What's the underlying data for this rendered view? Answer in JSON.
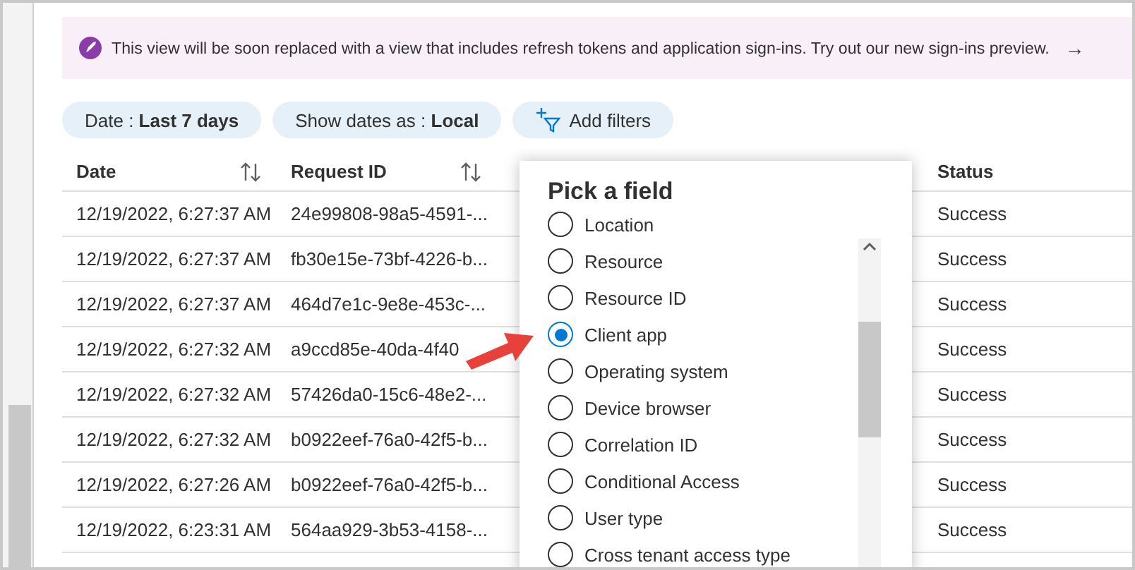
{
  "banner": {
    "text": "This view will be soon replaced with a view that includes refresh tokens and application sign-ins. Try out our new sign-ins preview.",
    "arrow": "→"
  },
  "filters": [
    {
      "label": "Date : ",
      "value": "Last 7 days"
    },
    {
      "label": "Show dates as : ",
      "value": "Local"
    }
  ],
  "add_filters": "Add filters",
  "table": {
    "columns": [
      {
        "label": "Date",
        "sortable": true
      },
      {
        "label": "Request ID",
        "sortable": true
      },
      {
        "label": "Status",
        "sortable": false
      }
    ],
    "rows": [
      {
        "date": "12/19/2022, 6:27:37 AM",
        "request_id": "24e99808-98a5-4591-...",
        "status": "Success"
      },
      {
        "date": "12/19/2022, 6:27:37 AM",
        "request_id": "fb30e15e-73bf-4226-b...",
        "status": "Success"
      },
      {
        "date": "12/19/2022, 6:27:37 AM",
        "request_id": "464d7e1c-9e8e-453c-...",
        "status": "Success"
      },
      {
        "date": "12/19/2022, 6:27:32 AM",
        "request_id": "a9ccd85e-40da-4f40",
        "status": "Success"
      },
      {
        "date": "12/19/2022, 6:27:32 AM",
        "request_id": "57426da0-15c6-48e2-...",
        "status": "Success"
      },
      {
        "date": "12/19/2022, 6:27:32 AM",
        "request_id": "b0922eef-76a0-42f5-b...",
        "status": "Success"
      },
      {
        "date": "12/19/2022, 6:27:26 AM",
        "request_id": "b0922eef-76a0-42f5-b...",
        "status": "Success"
      },
      {
        "date": "12/19/2022, 6:23:31 AM",
        "request_id": "564aa929-3b53-4158-...",
        "status": "Success"
      }
    ]
  },
  "popup": {
    "title": "Pick a field",
    "options": [
      {
        "label": "Location",
        "selected": false
      },
      {
        "label": "Resource",
        "selected": false
      },
      {
        "label": "Resource ID",
        "selected": false
      },
      {
        "label": "Client app",
        "selected": true
      },
      {
        "label": "Operating system",
        "selected": false
      },
      {
        "label": "Device browser",
        "selected": false
      },
      {
        "label": "Correlation ID",
        "selected": false
      },
      {
        "label": "Conditional Access",
        "selected": false
      },
      {
        "label": "User type",
        "selected": false
      },
      {
        "label": "Cross tenant access type",
        "selected": false
      }
    ]
  }
}
